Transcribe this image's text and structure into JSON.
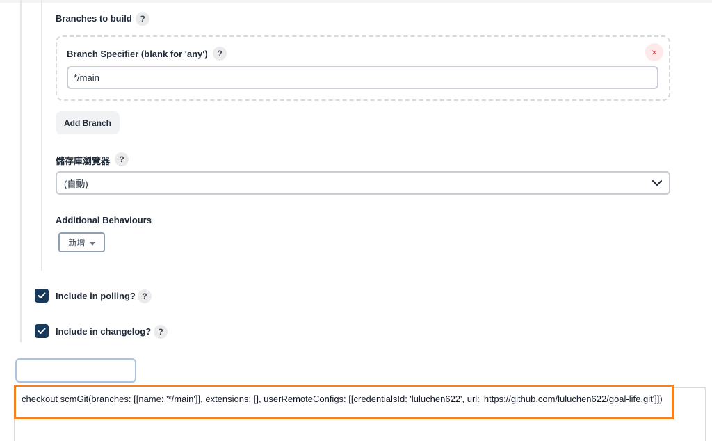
{
  "branches": {
    "title": "Branches to build",
    "help": "?",
    "specifier_label": "Branch Specifier (blank for 'any')",
    "specifier_value": "*/main",
    "remove_symbol": "×",
    "add_branch_label": "Add Branch"
  },
  "repo_browser": {
    "label": "儲存庫瀏覽器",
    "selected": "(自動)"
  },
  "behaviours": {
    "label": "Additional Behaviours",
    "add_label": "新增"
  },
  "options": {
    "include_polling": {
      "label": "Include in polling?",
      "checked": true
    },
    "include_changelog": {
      "label": "Include in changelog?",
      "checked": true
    }
  },
  "script": {
    "text": "checkout scmGit(branches: [[name: '*/main']], extensions: [], userRemoteConfigs: [[credentialsId: 'luluchen622', url: 'https://github.com/luluchen622/goal-life.git']])"
  },
  "colors": {
    "accent": "#173a5c",
    "highlight_border": "#f5821f",
    "remove": "#e53e3e"
  }
}
